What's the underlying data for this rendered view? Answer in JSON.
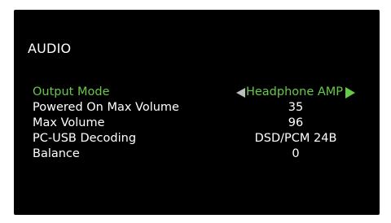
{
  "screen": {
    "title": "AUDIO"
  },
  "menu": {
    "items": [
      {
        "label": "Output Mode",
        "value": "Headphone AMP",
        "selected": true
      },
      {
        "label": "Powered On Max Volume",
        "value": "35"
      },
      {
        "label": "Max Volume",
        "value": "96"
      },
      {
        "label": "PC-USB Decoding",
        "value": "DSD/PCM 24B"
      },
      {
        "label": "Balance",
        "value": "0"
      }
    ]
  },
  "colors": {
    "background": "#000000",
    "text": "#ffffff",
    "selected": "#66c94a",
    "arrow_left": "#bdbdbd"
  },
  "icons": {
    "left": "triangle-left-icon",
    "right": "triangle-right-icon"
  }
}
